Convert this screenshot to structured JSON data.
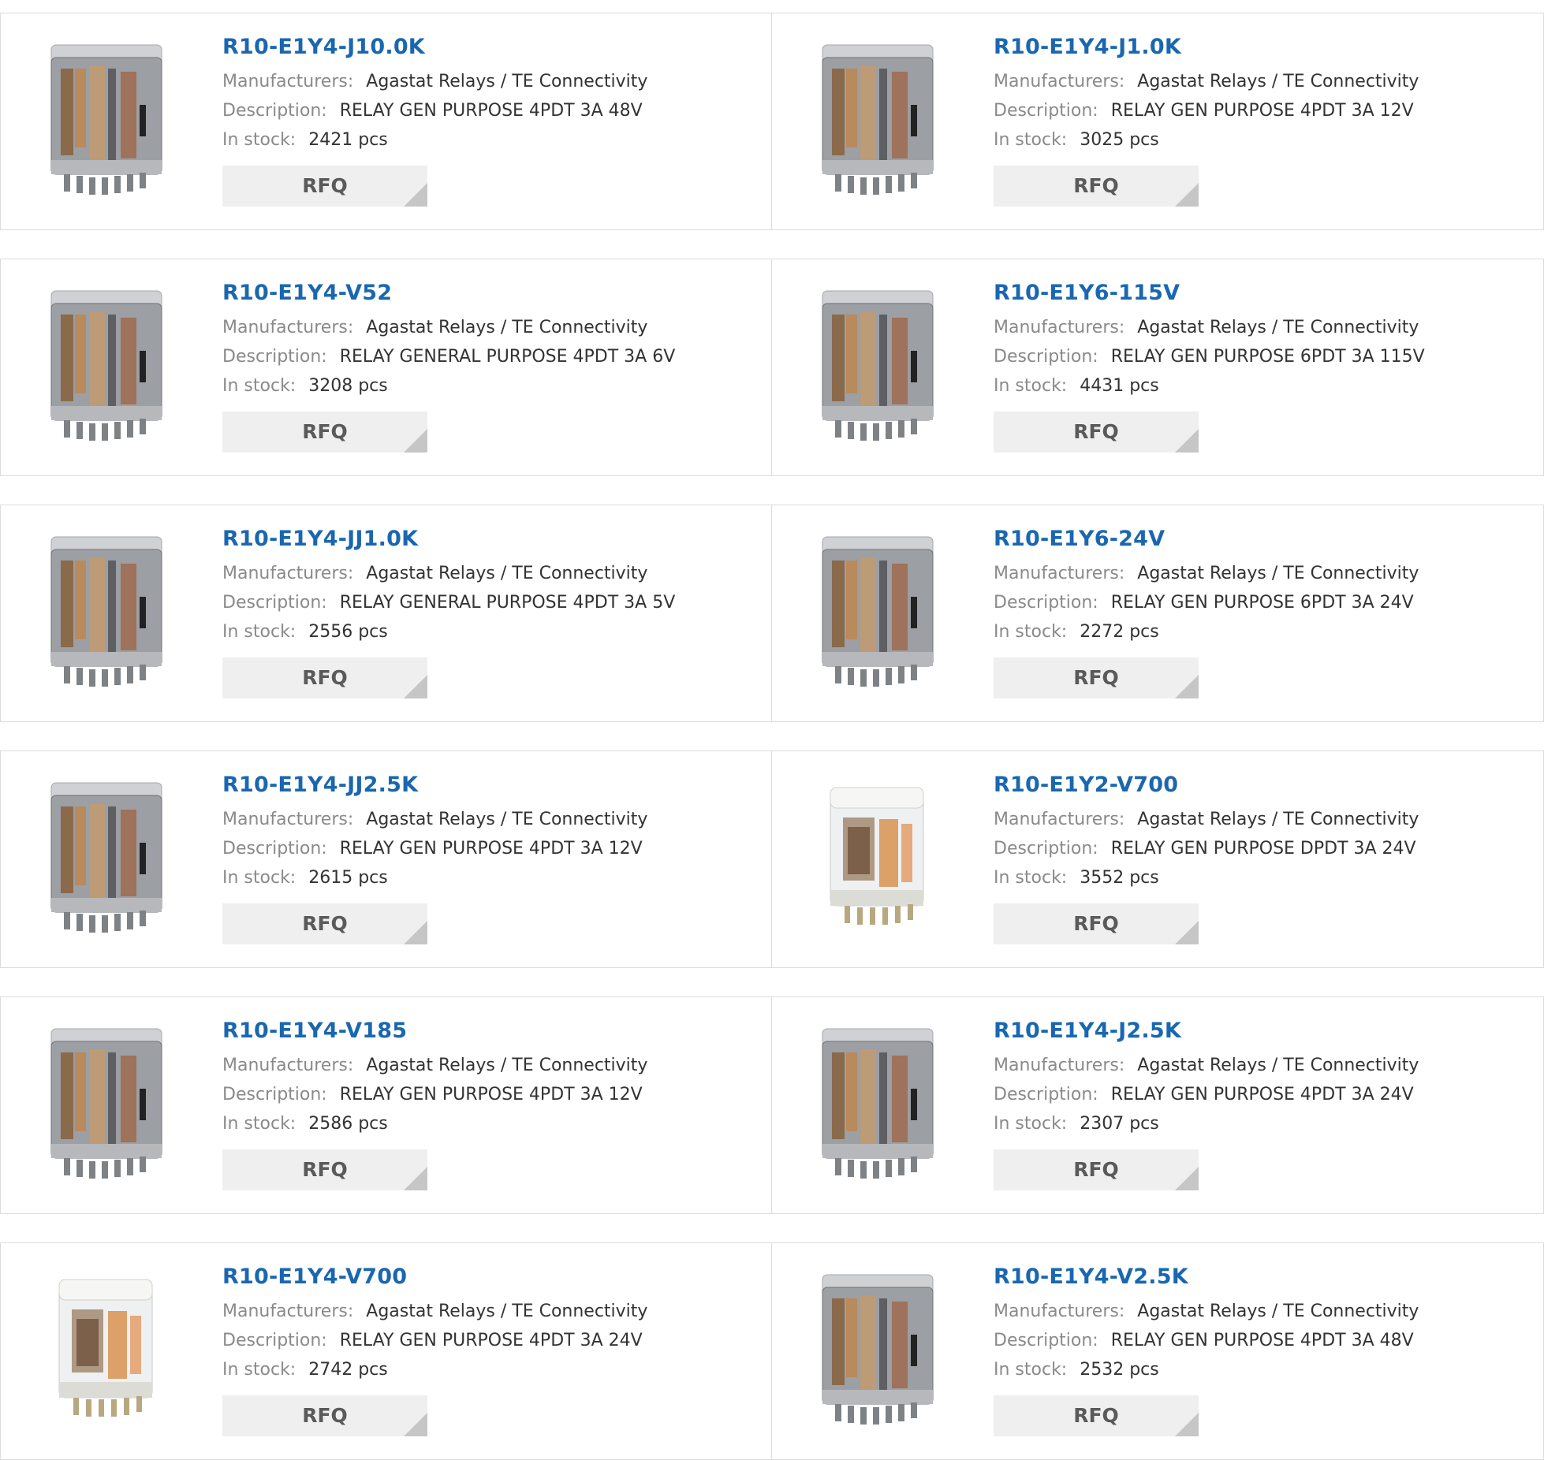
{
  "labels": {
    "manufacturers": "Manufacturers:",
    "description": "Description:",
    "in_stock": "In stock:",
    "rfq": "RFQ"
  },
  "products": [
    {
      "part": "R10-E1Y4-J10.0K",
      "manufacturer": "Agastat Relays / TE Connectivity",
      "description": "RELAY GEN PURPOSE 4PDT 3A 48V",
      "stock": "2421 pcs",
      "image": "relay-grey-icon"
    },
    {
      "part": "R10-E1Y4-J1.0K",
      "manufacturer": "Agastat Relays / TE Connectivity",
      "description": "RELAY GEN PURPOSE 4PDT 3A 12V",
      "stock": "3025 pcs",
      "image": "relay-grey-icon"
    },
    {
      "part": "R10-E1Y4-V52",
      "manufacturer": "Agastat Relays / TE Connectivity",
      "description": "RELAY GENERAL PURPOSE 4PDT 3A 6V",
      "stock": "3208 pcs",
      "image": "relay-grey-icon"
    },
    {
      "part": "R10-E1Y6-115V",
      "manufacturer": "Agastat Relays / TE Connectivity",
      "description": "RELAY GEN PURPOSE 6PDT 3A 115V",
      "stock": "4431 pcs",
      "image": "relay-grey-icon"
    },
    {
      "part": "R10-E1Y4-JJ1.0K",
      "manufacturer": "Agastat Relays / TE Connectivity",
      "description": "RELAY GENERAL PURPOSE 4PDT 3A 5V",
      "stock": "2556 pcs",
      "image": "relay-grey-icon"
    },
    {
      "part": "R10-E1Y6-24V",
      "manufacturer": "Agastat Relays / TE Connectivity",
      "description": "RELAY GEN PURPOSE 6PDT 3A 24V",
      "stock": "2272 pcs",
      "image": "relay-grey-icon"
    },
    {
      "part": "R10-E1Y4-JJ2.5K",
      "manufacturer": "Agastat Relays / TE Connectivity",
      "description": "RELAY GEN PURPOSE 4PDT 3A 12V",
      "stock": "2615 pcs",
      "image": "relay-grey-icon"
    },
    {
      "part": "R10-E1Y2-V700",
      "manufacturer": "Agastat Relays / TE Connectivity",
      "description": "RELAY GEN PURPOSE DPDT 3A 24V",
      "stock": "3552 pcs",
      "image": "relay-clear-icon"
    },
    {
      "part": "R10-E1Y4-V185",
      "manufacturer": "Agastat Relays / TE Connectivity",
      "description": "RELAY GEN PURPOSE 4PDT 3A 12V",
      "stock": "2586 pcs",
      "image": "relay-grey-icon"
    },
    {
      "part": "R10-E1Y4-J2.5K",
      "manufacturer": "Agastat Relays / TE Connectivity",
      "description": "RELAY GEN PURPOSE 4PDT 3A 24V",
      "stock": "2307 pcs",
      "image": "relay-grey-icon"
    },
    {
      "part": "R10-E1Y4-V700",
      "manufacturer": "Agastat Relays / TE Connectivity",
      "description": "RELAY GEN PURPOSE 4PDT 3A 24V",
      "stock": "2742 pcs",
      "image": "relay-clear-icon"
    },
    {
      "part": "R10-E1Y4-V2.5K",
      "manufacturer": "Agastat Relays / TE Connectivity",
      "description": "RELAY GEN PURPOSE 4PDT 3A 48V",
      "stock": "2532 pcs",
      "image": "relay-grey-icon"
    }
  ],
  "colors": {
    "part_link": "#1a67b0",
    "label_text": "#8a8a8a",
    "value_text": "#333333",
    "rfq_bg": "#efefef",
    "rfq_corner": "#c6c6c6",
    "card_border": "#dcdcdc"
  }
}
